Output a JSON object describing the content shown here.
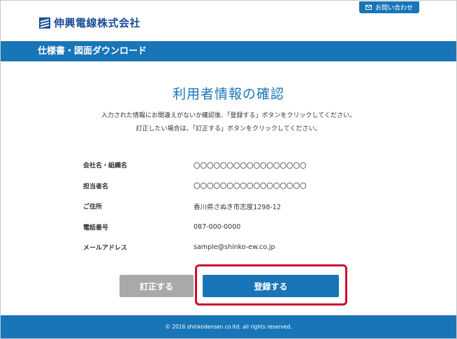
{
  "header": {
    "logo_text": "伸興電線株式会社",
    "logo_icon": "shinko-logo-mark",
    "contact_icon": "envelope-icon",
    "contact_label": "お問い合わせ"
  },
  "titlebar": {
    "title": "仕様書・図面ダウンロード"
  },
  "main": {
    "title": "利用者情報の確認",
    "desc_line1": "入力された情報にお間違えがないか確認後、「登録する」ボタンをクリックしてください。",
    "desc_line2": "訂正したい場合は、「訂正する」ボタンをクリックしてください。",
    "fields": [
      {
        "label": "会社名・組織名",
        "value": "〇〇〇〇〇〇〇〇〇〇〇〇〇〇〇〇〇"
      },
      {
        "label": "担当者名",
        "value": "〇〇〇〇〇〇〇〇〇〇〇〇〇〇〇〇〇"
      },
      {
        "label": "ご住所",
        "value": "香川県さぬき市志度1298-12"
      },
      {
        "label": "電話番号",
        "value": "087-000-0000"
      },
      {
        "label": "メールアドレス",
        "value": "sample@shinko-ew.co.jp"
      }
    ]
  },
  "buttons": {
    "correct_label": "訂正する",
    "register_label": "登録する"
  },
  "colors": {
    "brand_blue": "#1875b8",
    "logo_blue": "#1a4f96",
    "highlight_red": "#c8102e",
    "button_gray": "#a9a9a9"
  },
  "footer": {
    "copyright": "© 2016 shinkodensen co.ltd. all rights reserved."
  }
}
